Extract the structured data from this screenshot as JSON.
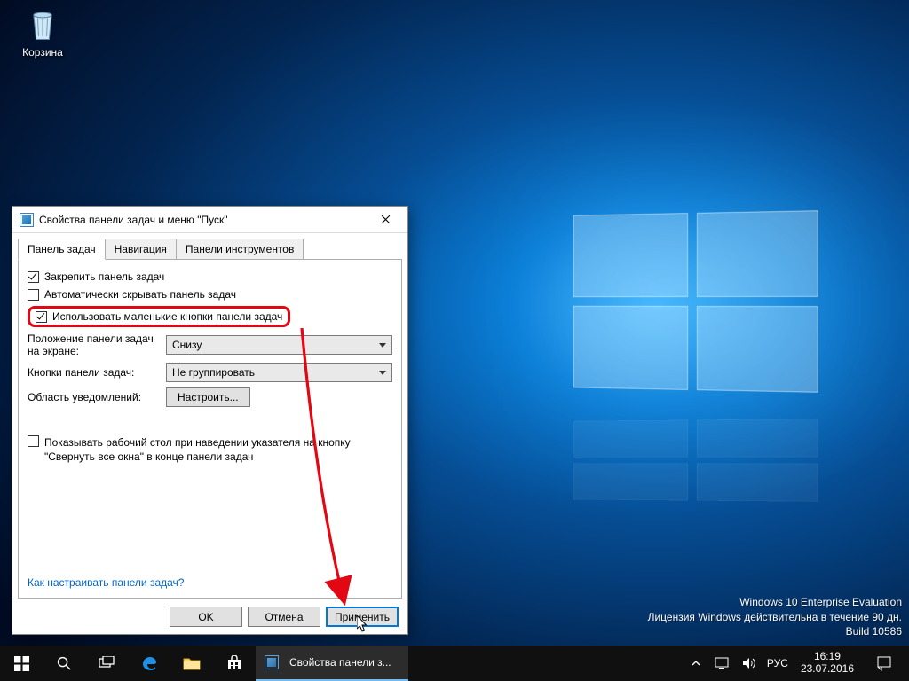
{
  "desktop": {
    "recycle_label": "Корзина"
  },
  "dialog": {
    "title": "Свойства панели задач и меню \"Пуск\"",
    "tabs": [
      "Панель задач",
      "Навигация",
      "Панели инструментов"
    ],
    "chk_lock": "Закрепить панель задач",
    "chk_autohide": "Автоматически скрывать панель задач",
    "chk_smallbtn": "Использовать маленькие кнопки панели задач",
    "lbl_position": "Положение панели задач на экране:",
    "sel_position": "Снизу",
    "lbl_buttons": "Кнопки панели задач:",
    "sel_buttons": "Не группировать",
    "lbl_notif": "Область уведомлений:",
    "btn_notif": "Настроить...",
    "chk_peek": "Показывать рабочий стол при наведении указателя на кнопку \"Свернуть все окна\" в конце панели задач",
    "helplink": "Как настраивать панели задач?",
    "btn_ok": "OK",
    "btn_cancel": "Отмена",
    "btn_apply": "Применить"
  },
  "taskbar": {
    "running": "Свойства панели з...",
    "lang": "РУС",
    "time": "16:19",
    "date": "23.07.2016"
  },
  "watermark": {
    "l1": "Windows 10 Enterprise Evaluation",
    "l2": "Лицензия Windows действительна в течение 90 дн.",
    "l3": "Build 10586"
  }
}
